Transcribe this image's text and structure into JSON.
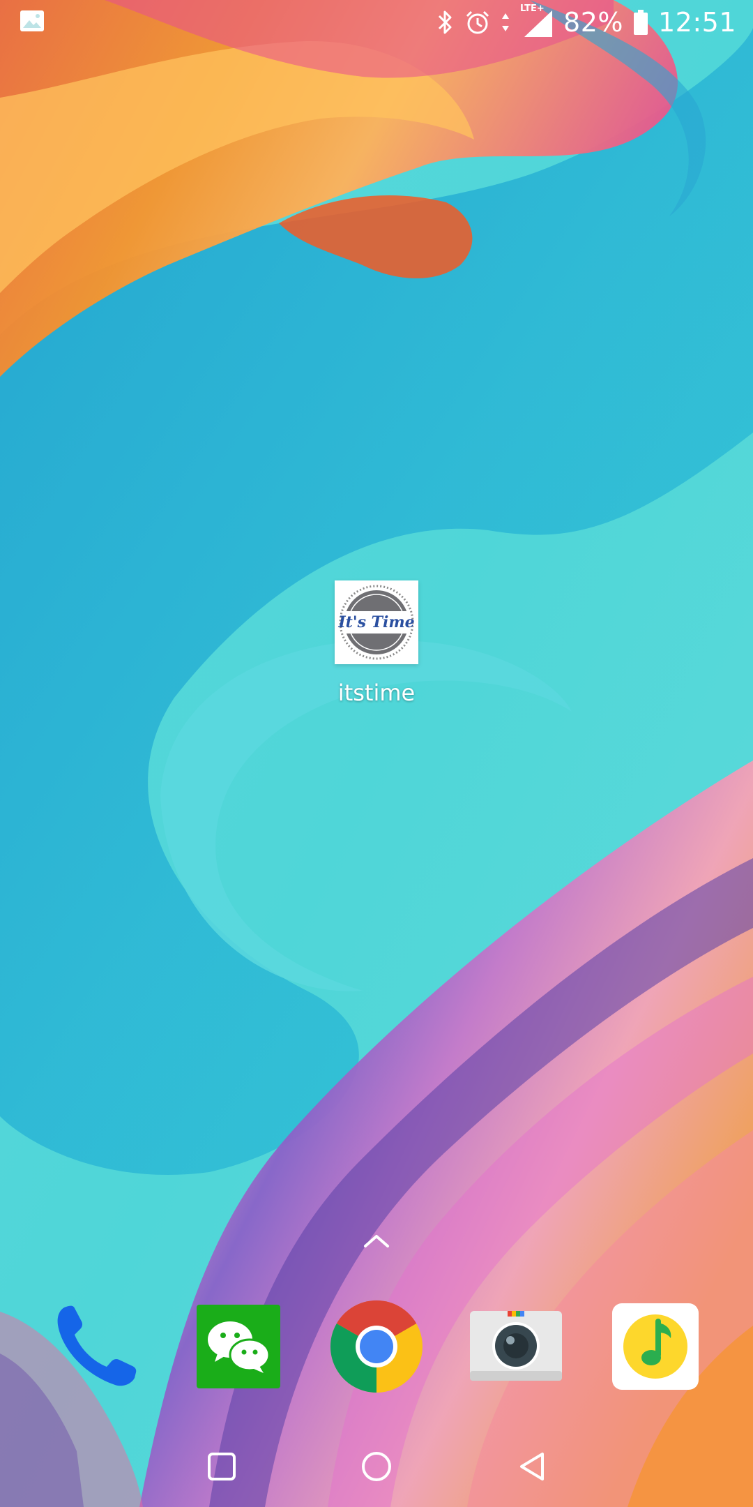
{
  "status_bar": {
    "left_icons": [
      "image-notification-icon"
    ],
    "right_icons": [
      "bluetooth-icon",
      "alarm-icon",
      "data-arrows-icon",
      "lte-signal-icon",
      "battery-icon"
    ],
    "network_label": "LTE+",
    "battery_percent": "82%",
    "time": "12:51"
  },
  "desktop": {
    "apps": [
      {
        "label": "itstime",
        "icon": "its-time-badge-icon",
        "badge_text": "It's Time"
      }
    ]
  },
  "dock": {
    "apps": [
      {
        "name": "Phone",
        "icon": "phone-icon"
      },
      {
        "name": "WeChat",
        "icon": "wechat-icon"
      },
      {
        "name": "Chrome",
        "icon": "chrome-icon"
      },
      {
        "name": "Camera",
        "icon": "camera-icon"
      },
      {
        "name": "QQ Music",
        "icon": "qq-music-icon"
      }
    ]
  },
  "nav_bar": {
    "buttons": [
      "recents-button",
      "home-button",
      "back-button"
    ]
  },
  "colors": {
    "wallpaper_base": "#43d1d6",
    "wallpaper_deep_blue": "#1fa3c9",
    "wallpaper_orange": "#f7942d",
    "wallpaper_pink": "#ef5b8a",
    "wallpaper_purple": "#6a4ca8",
    "status_text": "#ffffff"
  }
}
